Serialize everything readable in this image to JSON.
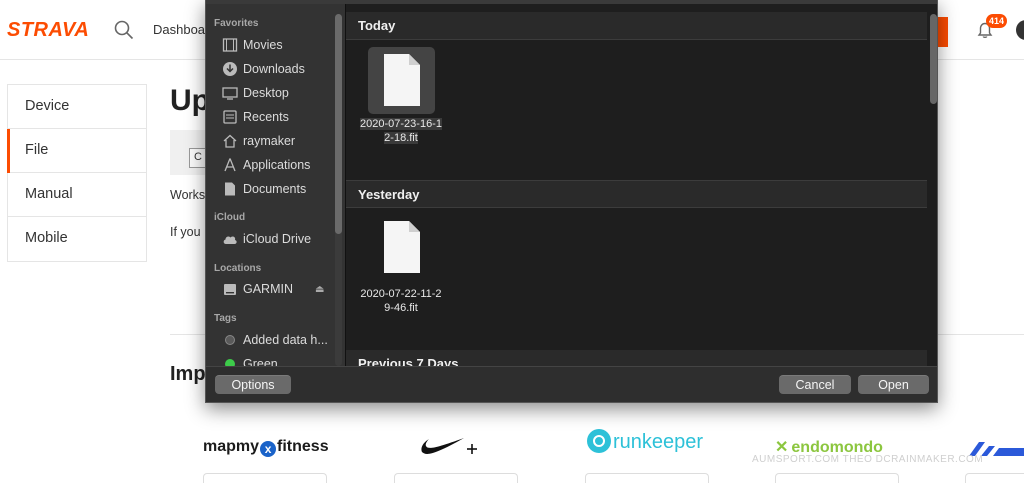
{
  "page": {
    "logo": "STRAVA",
    "nav_dashboard": "Dashboa",
    "notification_count": "414",
    "side_menu": [
      "Device",
      "File",
      "Manual",
      "Mobile"
    ],
    "title": "Up",
    "choose_btn": "C",
    "works_text": "Works",
    "ifyou_text": "If you",
    "imp_text": "Imp",
    "brands": [
      "mapmy",
      "fitness",
      "runkeeper",
      "endomondo"
    ],
    "watermark": "AUMSPORT.COM THEO DCRAINMAKER.COM",
    "accent": "#fc4c02"
  },
  "dialog": {
    "sidebar": {
      "favorites_label": "Favorites",
      "favorites": [
        "Movies",
        "Downloads",
        "Desktop",
        "Recents",
        "raymaker",
        "Applications",
        "Documents"
      ],
      "icloud_label": "iCloud",
      "icloud": [
        "iCloud Drive"
      ],
      "locations_label": "Locations",
      "locations": [
        "GARMIN"
      ],
      "tags_label": "Tags",
      "tags": [
        {
          "name": "Added data h...",
          "color": "#5a5a5a"
        },
        {
          "name": "Green",
          "color": "#3dcc4a"
        }
      ]
    },
    "groups": {
      "today": "Today",
      "yesterday": "Yesterday",
      "previous": "Previous 7 Days"
    },
    "files": {
      "today_line1": "2020-07-23-16-1",
      "today_line2": "2-18.fit",
      "yesterday_line1": "2020-07-22-11-2",
      "yesterday_line2": "9-46.fit"
    },
    "buttons": {
      "options": "Options",
      "cancel": "Cancel",
      "open": "Open"
    }
  }
}
